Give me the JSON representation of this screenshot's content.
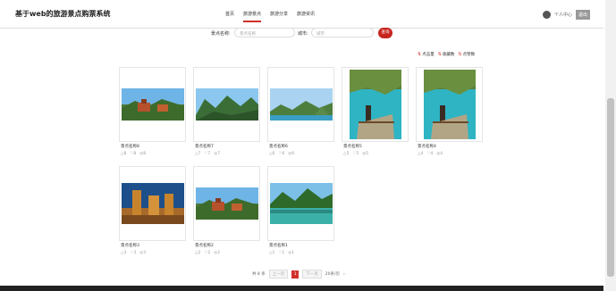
{
  "brand": "基于web的旅游景点购票系统",
  "nav": [
    {
      "label": "首页"
    },
    {
      "label": "旅游景点"
    },
    {
      "label": "旅游分享"
    },
    {
      "label": "旅游资讯"
    }
  ],
  "user": {
    "center": "个人中心",
    "logout": "退出"
  },
  "search": {
    "name_label": "景点名称:",
    "name_placeholder": "景点名称",
    "city_label": "城市:",
    "city_placeholder": "城市",
    "button": "查询"
  },
  "sort": [
    {
      "label": "点击量"
    },
    {
      "label": "收藏数"
    },
    {
      "label": "点赞数"
    }
  ],
  "spots": [
    {
      "name": "景点名称8",
      "likes": "8",
      "favs": "8",
      "views": "8"
    },
    {
      "name": "景点名称7",
      "likes": "7",
      "favs": "7",
      "views": "7"
    },
    {
      "name": "景点名称6",
      "likes": "6",
      "favs": "6",
      "views": "6"
    },
    {
      "name": "景点名称5",
      "likes": "5",
      "favs": "5",
      "views": "5"
    },
    {
      "name": "景点名称4",
      "likes": "4",
      "favs": "4",
      "views": "4"
    },
    {
      "name": "景点名称3",
      "likes": "3",
      "favs": "3",
      "views": "3"
    },
    {
      "name": "景点名称2",
      "likes": "2",
      "favs": "2",
      "views": "2"
    },
    {
      "name": "景点名称1",
      "likes": "1",
      "favs": "1",
      "views": "1"
    }
  ],
  "pager": {
    "total": "共 8 条",
    "prev": "上一页",
    "current": "1",
    "next": "下一页",
    "size": "20条/页"
  }
}
